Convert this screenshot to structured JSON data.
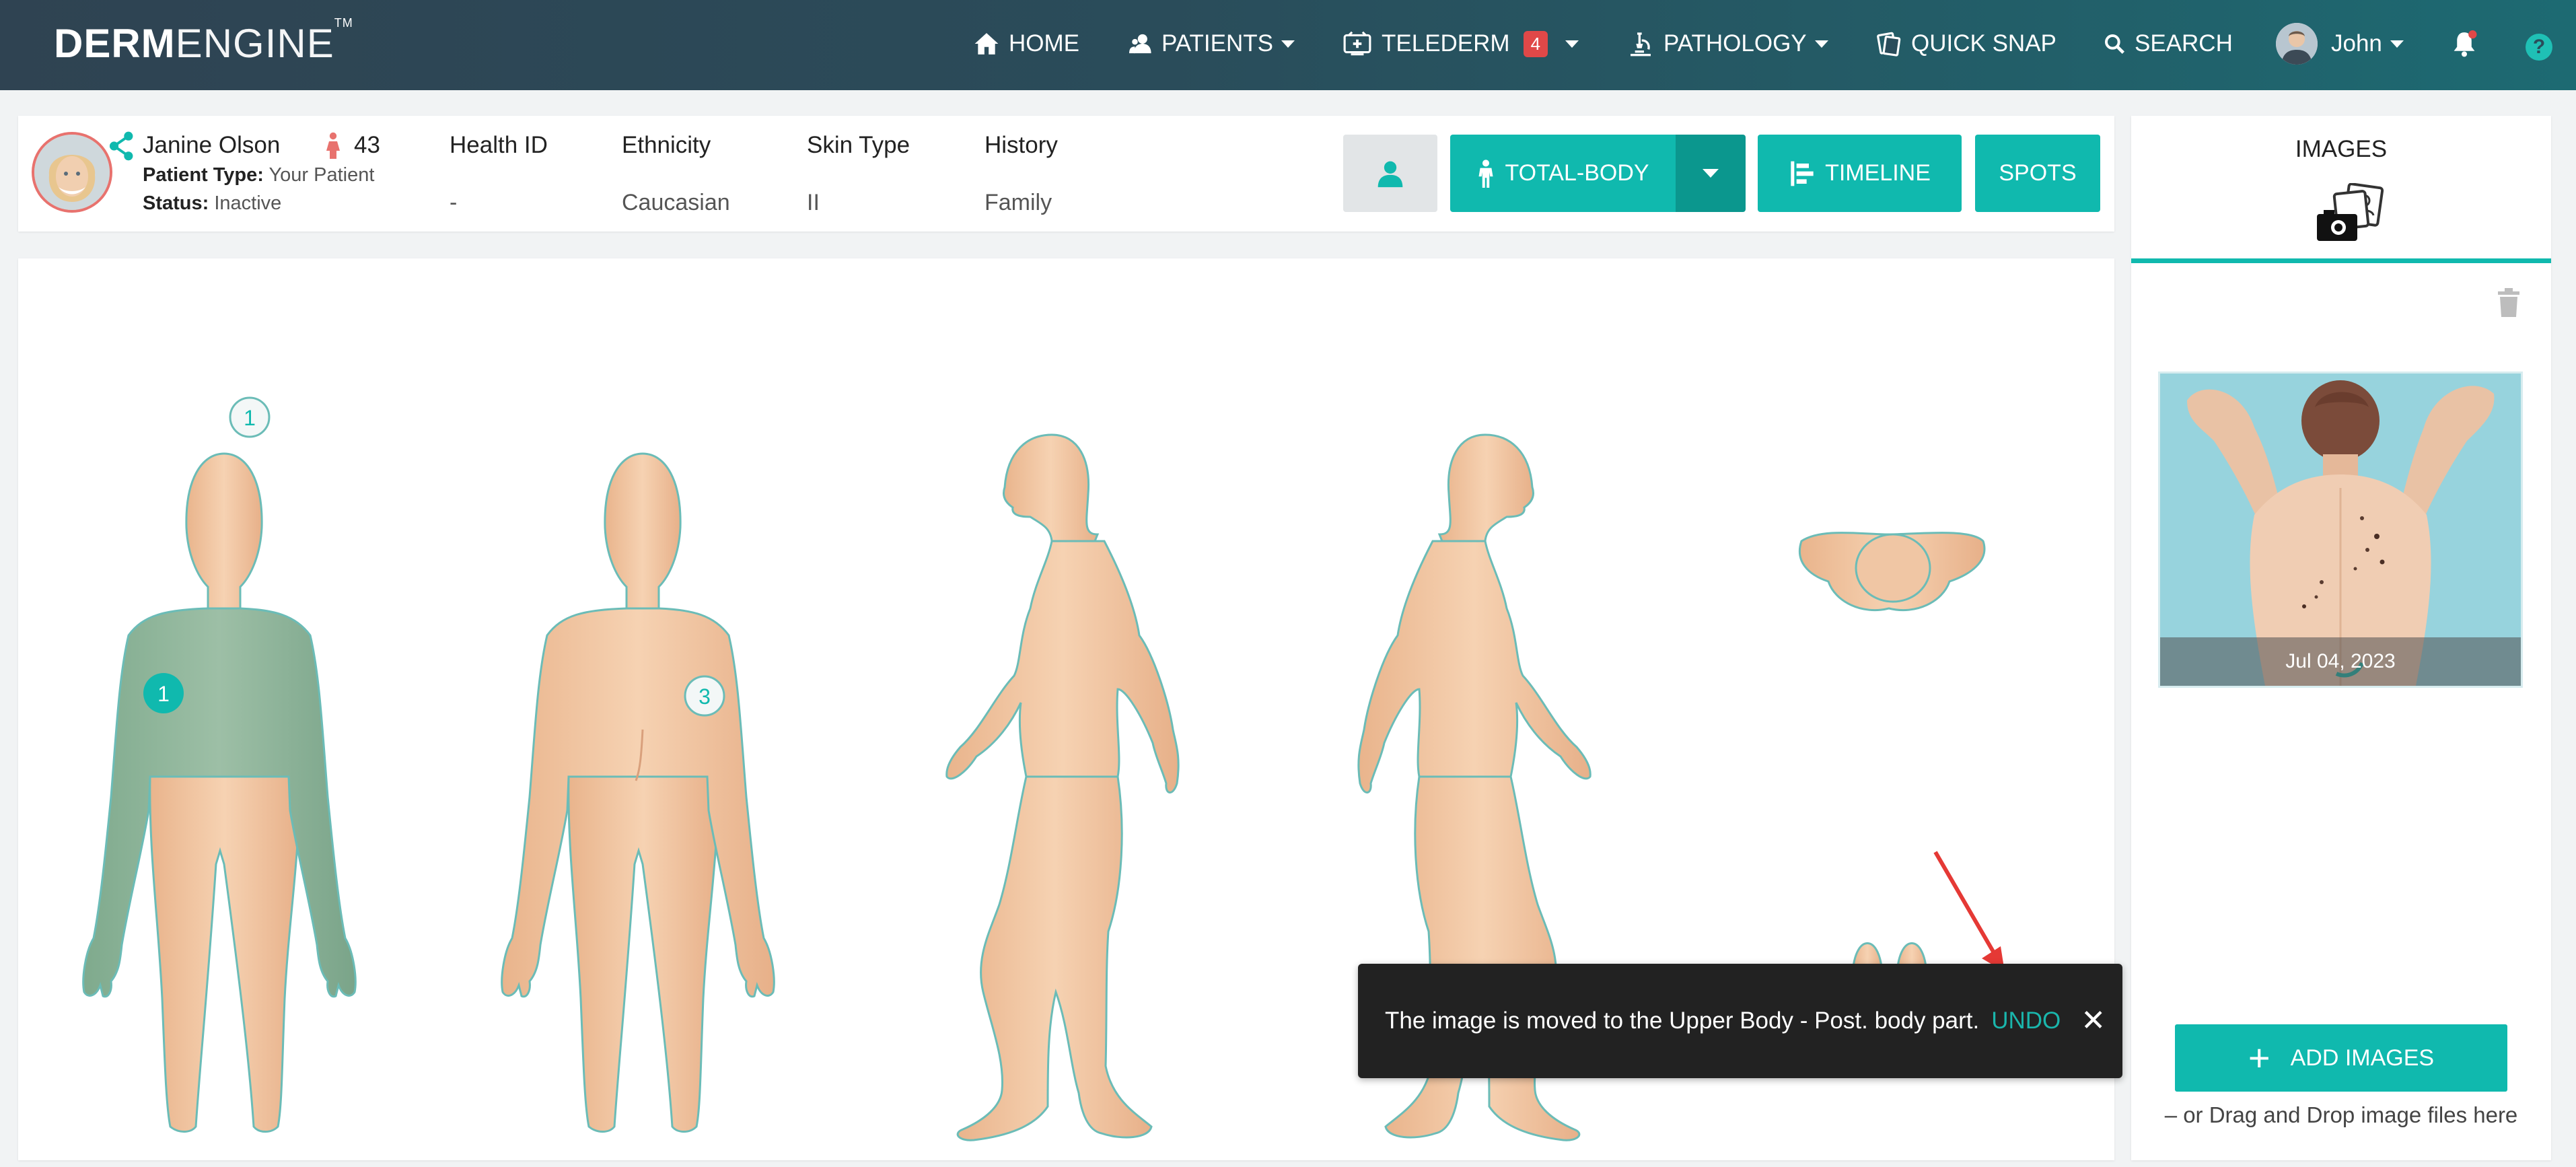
{
  "app": {
    "logo_bold": "DERM",
    "logo_light": "ENGINE",
    "logo_tm": "TM"
  },
  "nav": {
    "home": "HOME",
    "patients": "PATIENTS",
    "telederm": "TELEDERM",
    "telederm_badge": "4",
    "pathology": "PATHOLOGY",
    "quick_snap": "QUICK SNAP",
    "search": "SEARCH",
    "user": "John",
    "help": "?"
  },
  "patient": {
    "name": "Janine Olson",
    "age": "43",
    "type_label": "Patient Type:",
    "type_value": "Your Patient",
    "status_label": "Status:",
    "status_value": "Inactive",
    "columns": [
      {
        "header": "Health ID",
        "value": "-"
      },
      {
        "header": "Ethnicity",
        "value": "Caucasian"
      },
      {
        "header": "Skin Type",
        "value": "II"
      },
      {
        "header": "History",
        "value": "Family"
      }
    ]
  },
  "actions": {
    "total_body": "TOTAL-BODY",
    "timeline": "TIMELINE",
    "spots": "SPOTS"
  },
  "body_map": {
    "markers": [
      {
        "view": "front",
        "region": "head",
        "count": "1",
        "filled": false
      },
      {
        "view": "front",
        "region": "torso",
        "count": "1",
        "filled": true
      },
      {
        "view": "back",
        "region": "lower-back",
        "count": "3",
        "filled": false
      }
    ]
  },
  "toast": {
    "message": "The image is moved to the Upper Body - Post. body part.",
    "undo": "UNDO",
    "close": "✕"
  },
  "images_panel": {
    "title": "IMAGES",
    "thumbnail_date": "Jul 04, 2023",
    "add_button": "ADD IMAGES",
    "drag_text": "– or Drag and Drop image files here"
  },
  "colors": {
    "accent": "#10b9ae",
    "nav_start": "#2f4352",
    "nav_end": "#1d6a72",
    "skin": "#f2c7a3",
    "selected_region": "#8db59b",
    "toast_bg": "#222222"
  }
}
